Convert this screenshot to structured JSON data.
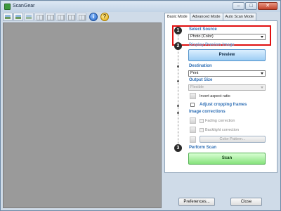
{
  "window": {
    "title": "ScanGear",
    "buttons": [
      "–",
      "□",
      "✕"
    ]
  },
  "toolbar": {
    "icons": [
      "scan-image-icon",
      "scan-image-icon",
      "scan-image-icon",
      "grid-icon",
      "grid-icon",
      "grid-icon",
      "grid-icon",
      "grid-icon",
      "info-icon",
      "help-icon"
    ],
    "info_glyph": "i",
    "help_glyph": "?"
  },
  "tabs": [
    {
      "label": "Basic Mode",
      "active": true
    },
    {
      "label": "Advanced Mode",
      "active": false
    },
    {
      "label": "Auto Scan Mode",
      "active": false
    }
  ],
  "panel": {
    "step1": {
      "number": "1",
      "label": "Select Source",
      "value": "Photo (Color)"
    },
    "step2": {
      "number": "2",
      "label": "Display Preview Image",
      "button": "Preview"
    },
    "destination": {
      "label": "Destination",
      "value": "Print"
    },
    "output_size": {
      "label": "Output Size",
      "value": "Flexible",
      "invert_label": "Invert aspect ratio"
    },
    "cropping": {
      "label": "Adjust cropping frames"
    },
    "corrections": {
      "label": "Image corrections",
      "fading": "Fading correction",
      "backlight": "Backlight correction",
      "color_pattern": "Color Pattern..."
    },
    "step3": {
      "number": "3",
      "label": "Perform Scan",
      "button": "Scan"
    }
  },
  "footer": {
    "preferences": "Preferences...",
    "close": "Close"
  },
  "colors": {
    "accent": "#2f6fb5",
    "highlight": "#e01010",
    "scan_green": "#86e27c",
    "preview_blue": "#9ccdf4"
  }
}
